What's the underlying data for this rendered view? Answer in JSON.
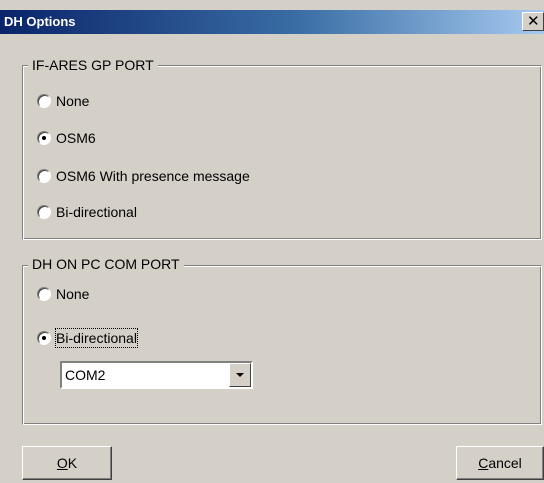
{
  "window": {
    "title": "DH Options",
    "close_icon": "close-icon"
  },
  "group_gp_port": {
    "legend": "IF-ARES GP PORT",
    "options": [
      {
        "label": "None",
        "selected": false
      },
      {
        "label": "OSM6",
        "selected": true
      },
      {
        "label": "OSM6 With presence message",
        "selected": false
      },
      {
        "label": "Bi-directional",
        "selected": false
      }
    ]
  },
  "group_com_port": {
    "legend": "DH ON PC COM PORT",
    "options": [
      {
        "label": "None",
        "selected": false
      },
      {
        "label": "Bi-directional",
        "selected": true
      }
    ],
    "com_select": {
      "value": "COM2",
      "icon": "chevron-down-icon"
    }
  },
  "buttons": {
    "ok_mnemonic": "O",
    "ok_rest": "K",
    "cancel_mnemonic": "C",
    "cancel_rest": "ancel"
  },
  "colors": {
    "face": "#d4d0c8",
    "title_start": "#0a246a",
    "title_end": "#a6caf0"
  }
}
